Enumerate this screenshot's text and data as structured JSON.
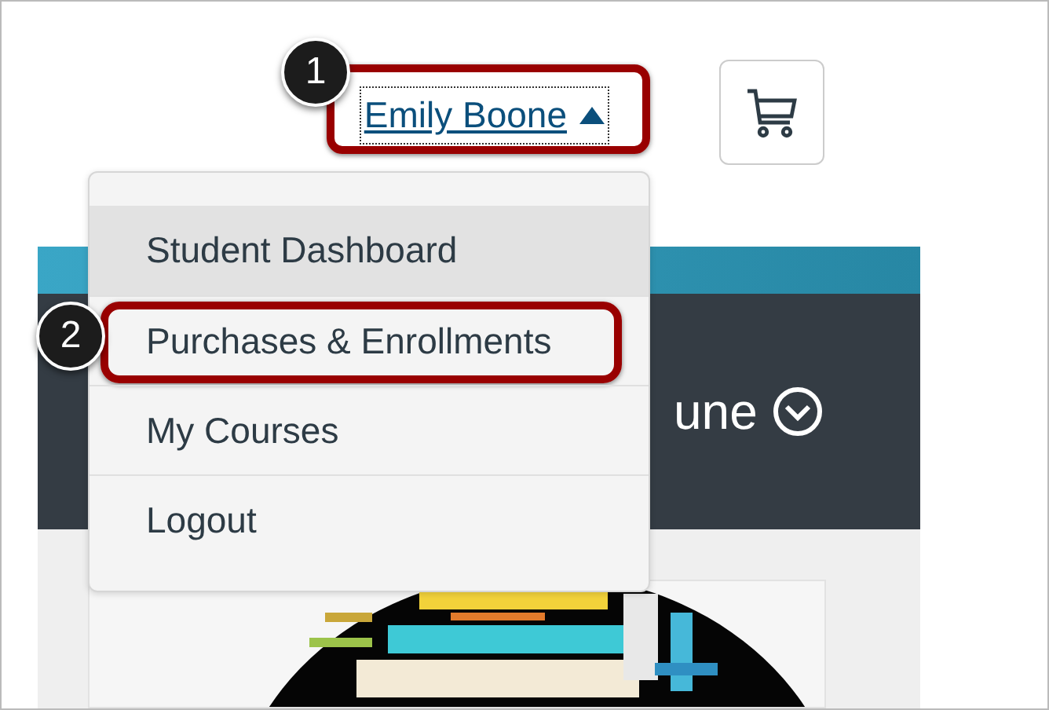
{
  "user_menu": {
    "name": "Emily Boone",
    "expanded": true
  },
  "menu_items": [
    {
      "label": "Student Dashboard",
      "selected": true
    },
    {
      "label": "Purchases & Enrollments",
      "selected": false
    },
    {
      "label": "My Courses",
      "selected": false
    },
    {
      "label": "Logout",
      "selected": false
    }
  ],
  "course_header": {
    "title": "une"
  },
  "callouts": [
    "1",
    "2"
  ]
}
